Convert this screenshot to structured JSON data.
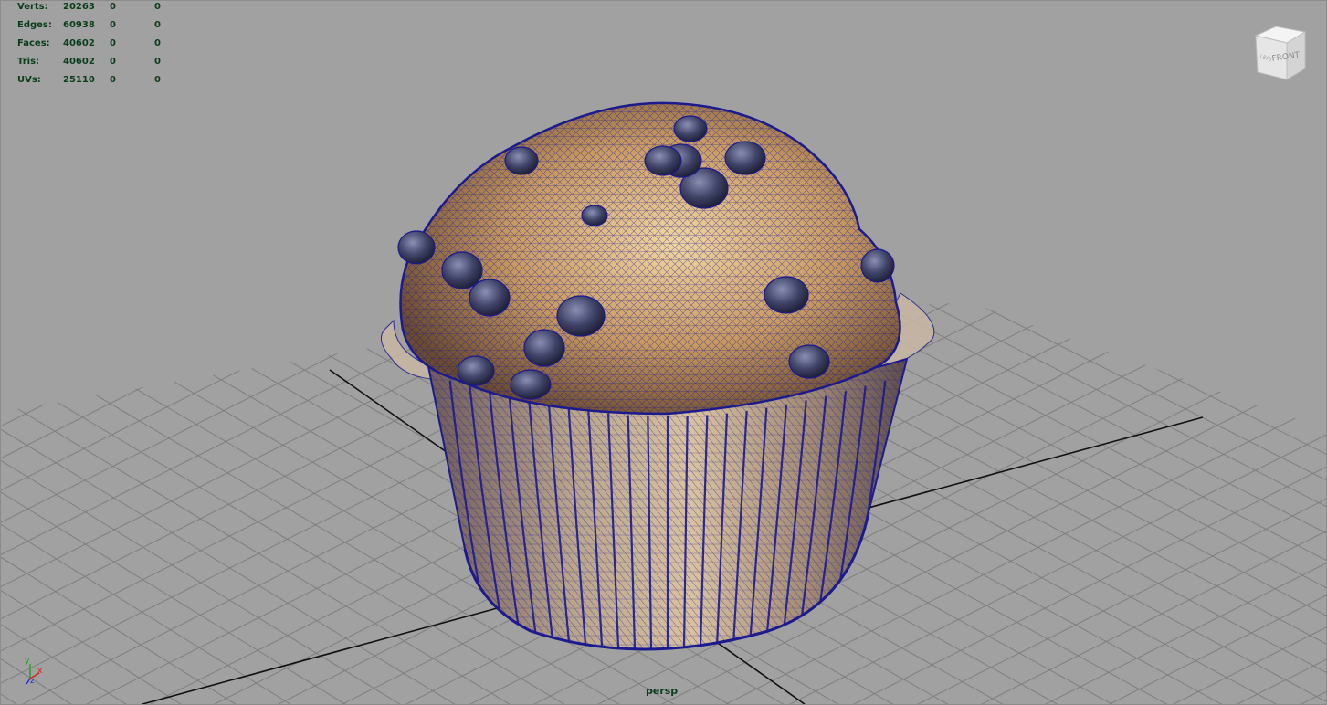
{
  "hud": {
    "rows": [
      {
        "label": "Verts:",
        "v1": "20263",
        "v2": "0",
        "v3": "0"
      },
      {
        "label": "Edges:",
        "v1": "60938",
        "v2": "0",
        "v3": "0"
      },
      {
        "label": "Faces:",
        "v1": "40602",
        "v2": "0",
        "v3": "0"
      },
      {
        "label": "Tris:",
        "v1": "40602",
        "v2": "0",
        "v3": "0"
      },
      {
        "label": "UVs:",
        "v1": "25110",
        "v2": "0",
        "v3": "0"
      }
    ]
  },
  "viewcube": {
    "front_label": "FRONT",
    "left_label": "LEFT"
  },
  "camera": {
    "name": "persp"
  },
  "axes": {
    "x": "x",
    "y": "y",
    "z": "z"
  },
  "colors": {
    "viewport_bg": "#a1a1a1",
    "grid_line": "#7e7e7e",
    "axis_line": "#111111",
    "wireframe": "#1b1a8f",
    "hud_text": "#0a3d1a"
  }
}
